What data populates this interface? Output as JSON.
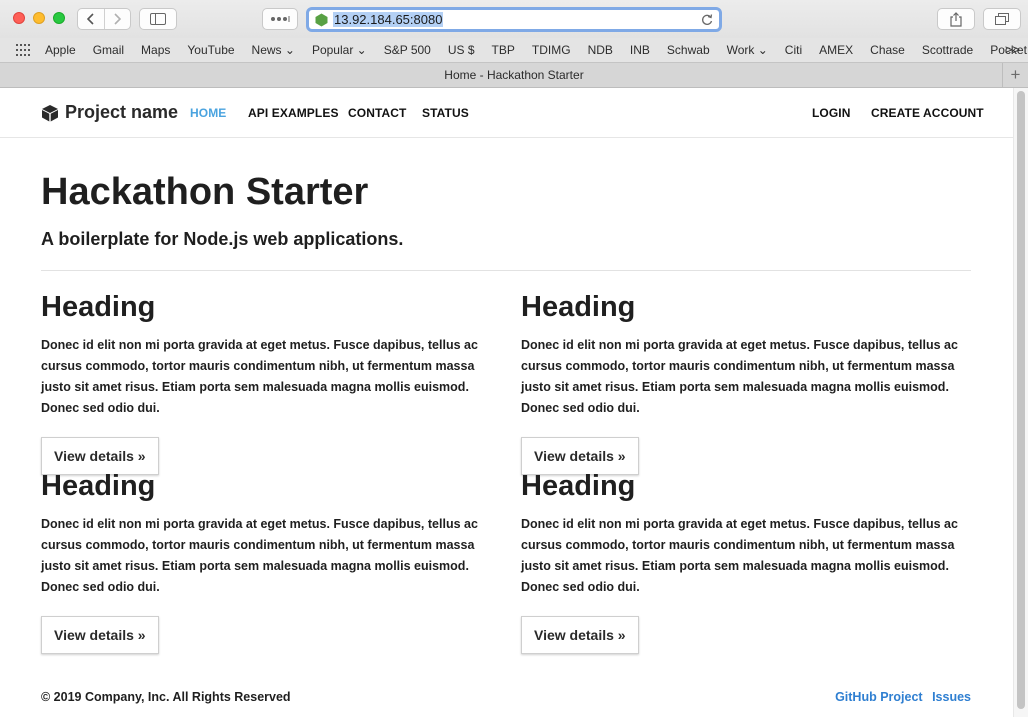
{
  "browser": {
    "url": "13.92.184.65:8080",
    "tab_title": "Home - Hackathon Starter",
    "bookmarks": [
      "Apple",
      "Gmail",
      "Maps",
      "YouTube",
      "News ⌄",
      "Popular ⌄",
      "S&P 500",
      "US $",
      "TBP",
      "TDIMG",
      "NDB",
      "INB",
      "Schwab",
      "Work ⌄",
      "Citi",
      "AMEX",
      "Chase",
      "Scottrade",
      "Pocket"
    ],
    "more_bookmarks": ">>",
    "new_tab": "+",
    "accent_color": "#7fa9e6"
  },
  "site": {
    "brand": "Project name",
    "nav": {
      "home": "HOME",
      "api_examples": "API EXAMPLES",
      "contact": "CONTACT",
      "status": "STATUS",
      "login": "LOGIN",
      "create_account": "CREATE ACCOUNT"
    },
    "active_nav_color": "#4aa3df",
    "title": "Hackathon Starter",
    "subtitle": "A boilerplate for Node.js web applications.",
    "cards": [
      {
        "heading": "Heading",
        "body": "Donec id elit non mi porta gravida at eget metus. Fusce dapibus, tellus ac cursus commodo, tortor mauris condimentum nibh, ut fermentum massa justo sit amet risus. Etiam porta sem malesuada magna mollis euismod. Donec sed odio dui.",
        "button": "View details »"
      },
      {
        "heading": "Heading",
        "body": "Donec id elit non mi porta gravida at eget metus. Fusce dapibus, tellus ac cursus commodo, tortor mauris condimentum nibh, ut fermentum massa justo sit amet risus. Etiam porta sem malesuada magna mollis euismod. Donec sed odio dui.",
        "button": "View details »"
      },
      {
        "heading": "Heading",
        "body": "Donec id elit non mi porta gravida at eget metus. Fusce dapibus, tellus ac cursus commodo, tortor mauris condimentum nibh, ut fermentum massa justo sit amet risus. Etiam porta sem malesuada magna mollis euismod. Donec sed odio dui.",
        "button": "View details »"
      },
      {
        "heading": "Heading",
        "body": "Donec id elit non mi porta gravida at eget metus. Fusce dapibus, tellus ac cursus commodo, tortor mauris condimentum nibh, ut fermentum massa justo sit amet risus. Etiam porta sem malesuada magna mollis euismod. Donec sed odio dui.",
        "button": "View details »"
      }
    ],
    "footer": {
      "copyright": "© 2019 Company, Inc. All Rights Reserved",
      "github": "GitHub Project",
      "issues": "Issues",
      "link_color": "#2f7fd1"
    }
  }
}
